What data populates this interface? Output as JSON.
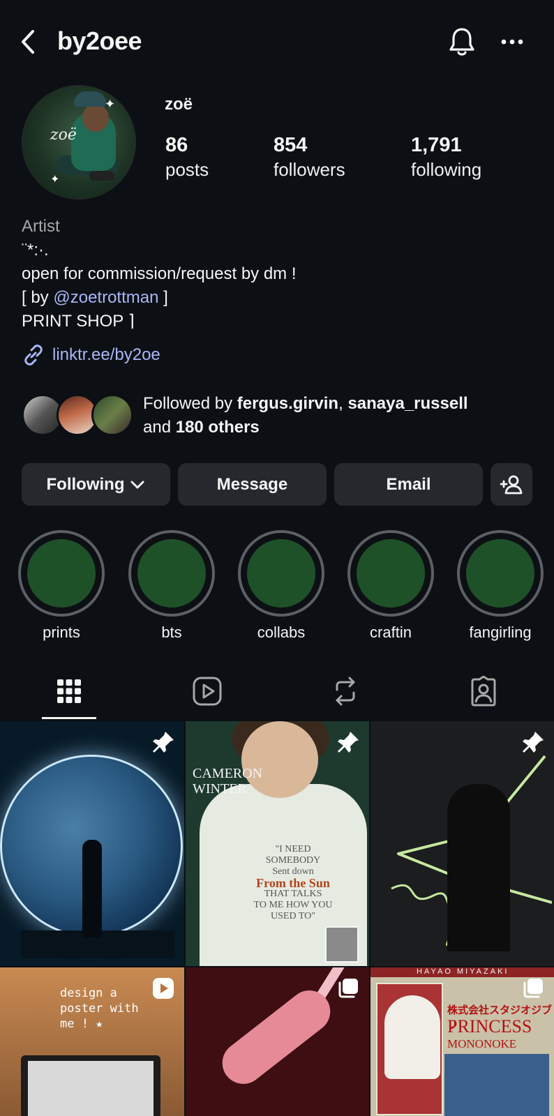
{
  "header": {
    "username": "by2oee",
    "back_icon": "chevron-left-icon",
    "bell_icon": "bell-icon",
    "more_icon": "more-horizontal-icon"
  },
  "profile": {
    "display_name": "zoë",
    "avatar_signature": "zoë",
    "stats": {
      "posts_count": "86",
      "posts_label": "posts",
      "followers_count": "854",
      "followers_label": "followers",
      "following_count": "1,791",
      "following_label": "following"
    }
  },
  "bio": {
    "category": "Artist",
    "decor": "¨*:·.",
    "line1": "open for commission/request by dm !",
    "line2_prefix": "[ by ",
    "line2_mention": "@zoetrottman",
    "line2_suffix": " ]",
    "line3": "PRINT SHOP ⌉",
    "link": "linktr.ee/by2oe"
  },
  "followed_by": {
    "prefix": "Followed by ",
    "user1": "fergus.girvin",
    "sep": ", ",
    "user2": "sanaya_russell",
    "and": "and ",
    "others": "180 others"
  },
  "actions": {
    "following": "Following",
    "message": "Message",
    "email": "Email"
  },
  "highlights": [
    {
      "label": "prints"
    },
    {
      "label": "bts"
    },
    {
      "label": "collabs"
    },
    {
      "label": "craftin"
    },
    {
      "label": "fangirling"
    }
  ],
  "tabs": [
    "grid-icon",
    "reels-icon",
    "reposts-icon",
    "tagged-icon"
  ],
  "posts": {
    "p2_title_1": "CAMERON",
    "p2_title_2": "WINTER",
    "p2_quote_1": "\"I NEED",
    "p2_quote_2": "SOMEBODY",
    "p2_quote_3": "Sent down",
    "p2_quote_4": "From the Sun",
    "p2_quote_5": "THAT TALKS",
    "p2_quote_6": "TO ME HOW YOU",
    "p2_quote_7": "USED TO\"",
    "p4_caption_1": "design a",
    "p4_caption_2": "poster with",
    "p4_caption_3": "me ! ★",
    "p6_director": "HAYAO MIYAZAKI",
    "p6_jp": "株式会社スタジオジブリ",
    "p6_title": "PRINCESS",
    "p6_sub": "MONONOKE"
  },
  "colors": {
    "background": "#0c1014",
    "button": "#25292e",
    "link": "#a9b6f7",
    "highlight_fill": "#1f5129"
  }
}
